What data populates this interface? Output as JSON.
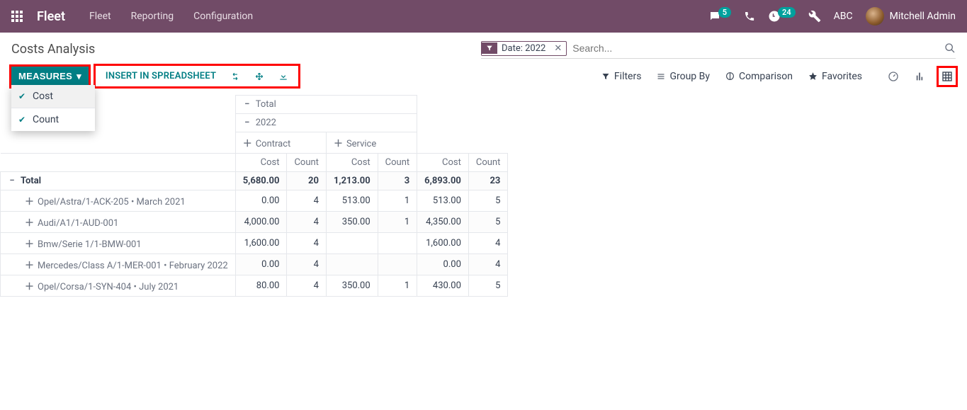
{
  "navbar": {
    "app_title": "Fleet",
    "links": [
      "Fleet",
      "Reporting",
      "Configuration"
    ],
    "chat_badge": "5",
    "activity_badge": "24",
    "company": "ABC",
    "user": "Mitchell Admin"
  },
  "page": {
    "title": "Costs Analysis"
  },
  "search": {
    "facet_label": "Date: 2022",
    "placeholder": "Search..."
  },
  "toolbar": {
    "measures_label": "MEASURES",
    "insert_label": "INSERT IN SPREADSHEET"
  },
  "filters": {
    "filters": "Filters",
    "group_by": "Group By",
    "comparison": "Comparison",
    "favorites": "Favorites"
  },
  "measures_menu": {
    "cost": "Cost",
    "count": "Count"
  },
  "pivot": {
    "col_total": "Total",
    "col_year": "2022",
    "col_contract": "Contract",
    "col_service": "Service",
    "m_cost": "Cost",
    "m_count": "Count",
    "row_total": "Total",
    "rows": [
      {
        "label": "Opel/Astra/1-ACK-205 • March 2021",
        "c_cost": "0.00",
        "c_count": "4",
        "s_cost": "513.00",
        "s_count": "1",
        "t_cost": "513.00",
        "t_count": "5"
      },
      {
        "label": "Audi/A1/1-AUD-001",
        "c_cost": "4,000.00",
        "c_count": "4",
        "s_cost": "350.00",
        "s_count": "1",
        "t_cost": "4,350.00",
        "t_count": "5"
      },
      {
        "label": "Bmw/Serie 1/1-BMW-001",
        "c_cost": "1,600.00",
        "c_count": "4",
        "s_cost": "",
        "s_count": "",
        "t_cost": "1,600.00",
        "t_count": "4"
      },
      {
        "label": "Mercedes/Class A/1-MER-001 • February 2022",
        "c_cost": "0.00",
        "c_count": "4",
        "s_cost": "",
        "s_count": "",
        "t_cost": "0.00",
        "t_count": "4"
      },
      {
        "label": "Opel/Corsa/1-SYN-404 • July 2021",
        "c_cost": "80.00",
        "c_count": "4",
        "s_cost": "350.00",
        "s_count": "1",
        "t_cost": "430.00",
        "t_count": "5"
      }
    ],
    "totals": {
      "c_cost": "5,680.00",
      "c_count": "20",
      "s_cost": "1,213.00",
      "s_count": "3",
      "t_cost": "6,893.00",
      "t_count": "23"
    }
  }
}
